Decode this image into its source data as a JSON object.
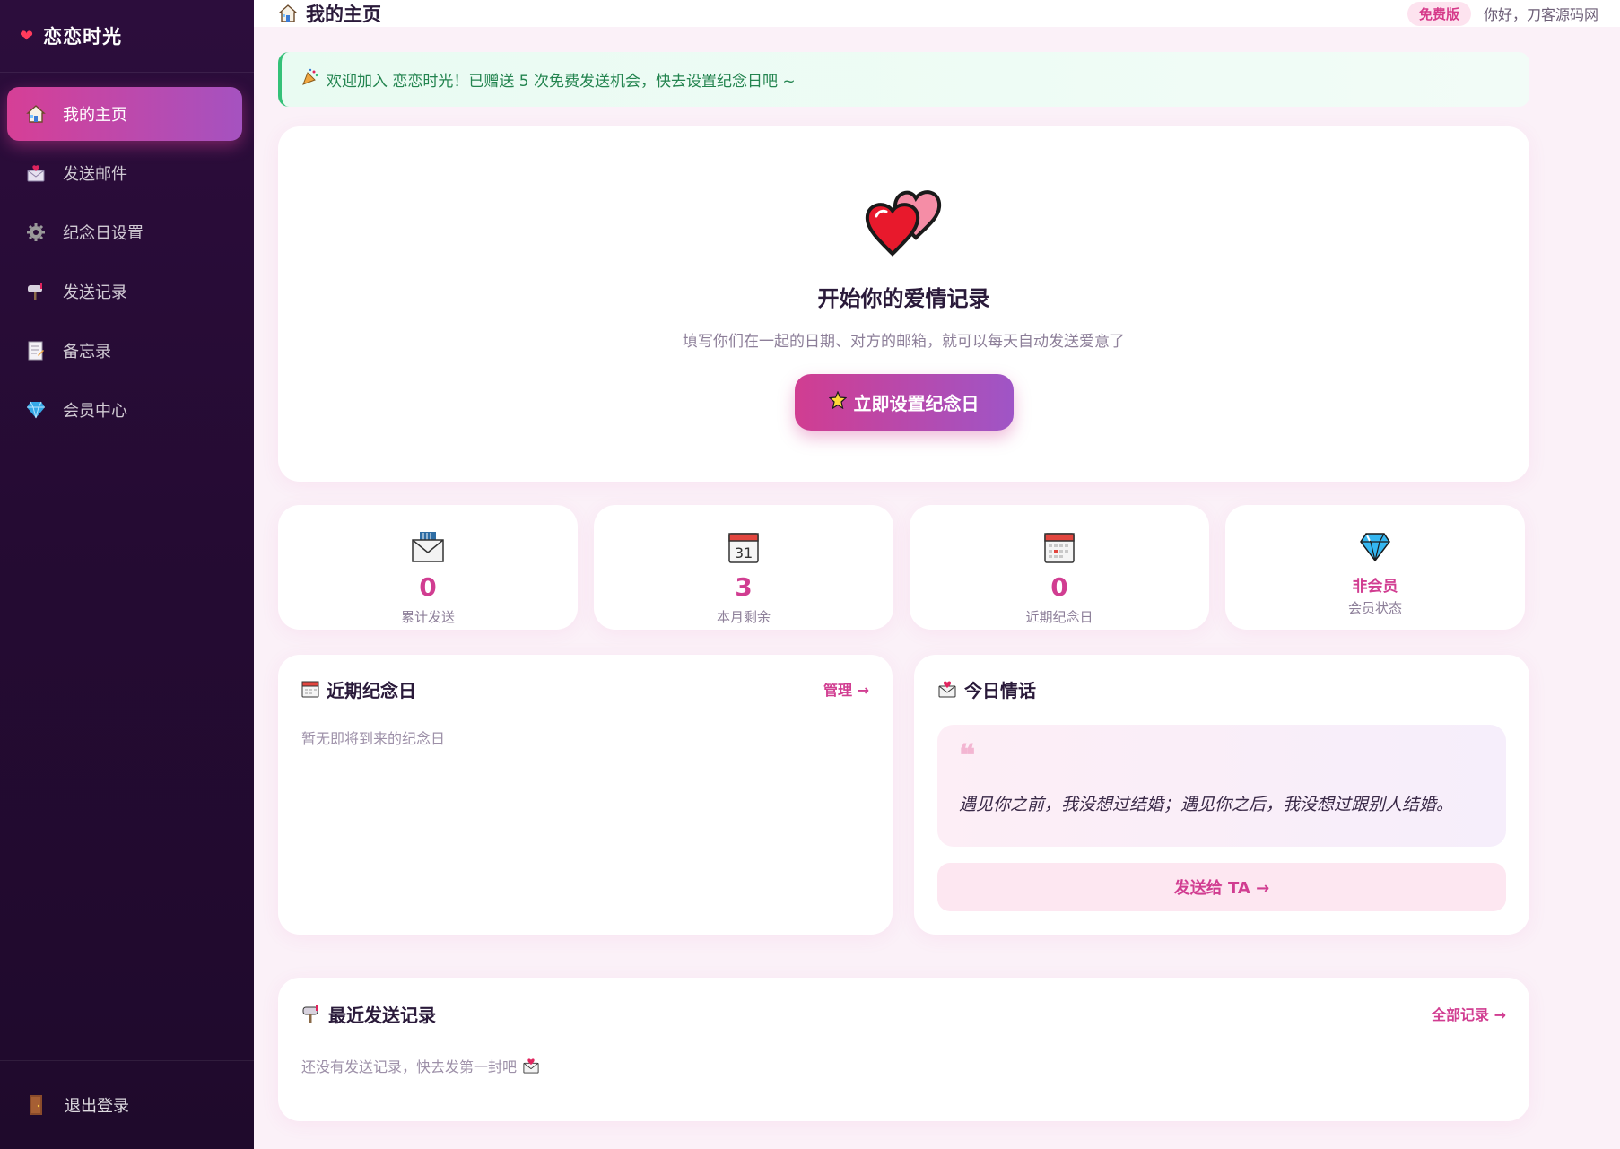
{
  "app": {
    "name": "恋恋时光"
  },
  "sidebar": {
    "items": [
      {
        "label": "我的主页",
        "icon": "house-icon",
        "active": true
      },
      {
        "label": "发送邮件",
        "icon": "envelope-icon"
      },
      {
        "label": "纪念日设置",
        "icon": "gear-icon"
      },
      {
        "label": "发送记录",
        "icon": "mailbox-icon"
      },
      {
        "label": "备忘录",
        "icon": "memo-icon"
      },
      {
        "label": "会员中心",
        "icon": "diamond-icon"
      }
    ],
    "logout_label": "退出登录"
  },
  "header": {
    "title": "我的主页",
    "plan_badge": "免费版",
    "greeting": "你好，刀客源码网"
  },
  "welcome": {
    "text": "欢迎加入 恋恋时光！已赠送 5 次免费发送机会，快去设置纪念日吧 ~"
  },
  "hero": {
    "title": "开始你的爱情记录",
    "subtitle": "填写你们在一起的日期、对方的邮箱，就可以每天自动发送爱意了",
    "button_label": "立即设置纪念日"
  },
  "stats": [
    {
      "value": "0",
      "label": "累计发送",
      "icon": "mailbox-envelope-icon"
    },
    {
      "value": "3",
      "label": "本月剩余",
      "icon": "calendar-31-icon",
      "calendar_day": "31"
    },
    {
      "value": "0",
      "label": "近期纪念日",
      "icon": "calendar-icon"
    },
    {
      "value": "非会员",
      "label": "会员状态",
      "icon": "diamond-icon"
    }
  ],
  "upcoming": {
    "title": "近期纪念日",
    "link": "管理 →",
    "empty_text": "暂无即将到来的纪念日"
  },
  "love_quote": {
    "title": "今日情话",
    "quote_mark": "❝",
    "text": "遇见你之前，我没想过结婚；遇见你之后，我没想过跟别人结婚。",
    "button_label": "发送给 TA →"
  },
  "recent": {
    "title": "最近发送记录",
    "link": "全部记录 →",
    "empty_text": "还没有发送记录，快去发第一封吧"
  },
  "colors": {
    "accent": "#d13d91",
    "accent2": "#9f55c6",
    "sidebar_bg": "#250b33",
    "success": "#34c178"
  }
}
